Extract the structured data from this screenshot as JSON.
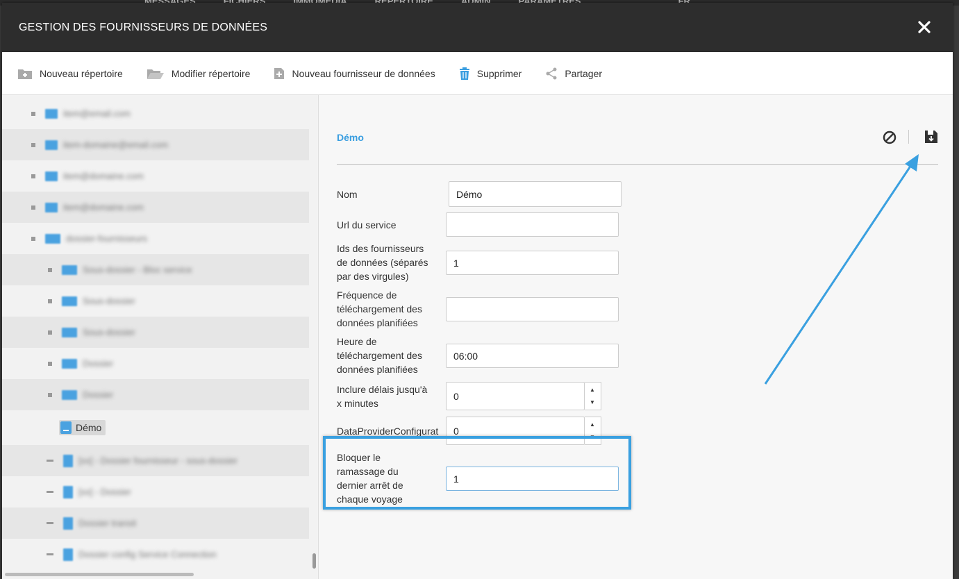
{
  "app_bar": {
    "menu": [
      "MESSAGES",
      "FICHIERS",
      "IMMOMEDIA",
      "RÉPERTOIRE",
      "ADMIN",
      "PARAMÈTRES",
      "FR"
    ]
  },
  "dialog": {
    "title": "GESTION DES FOURNISSEURS DE DONNÉES",
    "close_icon": "close-icon"
  },
  "toolbar": {
    "new_folder": "Nouveau répertoire",
    "edit_folder": "Modifier répertoire",
    "new_provider": "Nouveau fournisseur de données",
    "delete": "Supprimer",
    "share": "Partager"
  },
  "tree": {
    "selected_item": "Démo",
    "blurred_items": [
      "item@email.com",
      "item-domaine@email.com",
      "item@domaine.com",
      "item@domaine.com",
      "dossier-fournisseurs",
      "Sous-dossier - Bloc service",
      "Sous-dossier",
      "Sous-dossier",
      "Dossier",
      "Dossier",
      "[xx] - Dossier fournisseur - sous-dossier",
      "[xx] - Dossier",
      "Dossier transit",
      "Dossier config Service Connection"
    ]
  },
  "form": {
    "title": "Démo",
    "fields": {
      "name": {
        "label": "Nom",
        "value": "Démo"
      },
      "service_url": {
        "label": "Url du service",
        "value": ""
      },
      "provider_ids": {
        "label": "Ids des fournisseurs de données (séparés par des virgules)",
        "value": "1"
      },
      "download_frequency": {
        "label": "Fréquence de téléchargement des données planifiées",
        "value": ""
      },
      "download_time": {
        "label": "Heure de téléchargement des données planifiées",
        "value": "06:00"
      },
      "include_delays": {
        "label": "Inclure délais jusqu'à x minutes",
        "value": "0"
      },
      "config": {
        "label": "DataProviderConfigurat",
        "value": "0"
      },
      "block_pickup": {
        "label": "Bloquer le ramassage du dernier arrêt de chaque voyage",
        "value": "1"
      }
    }
  },
  "colors": {
    "accent": "#3a9ee0",
    "header_bg": "#2d2d2d",
    "highlight": "#3aa0e0"
  }
}
